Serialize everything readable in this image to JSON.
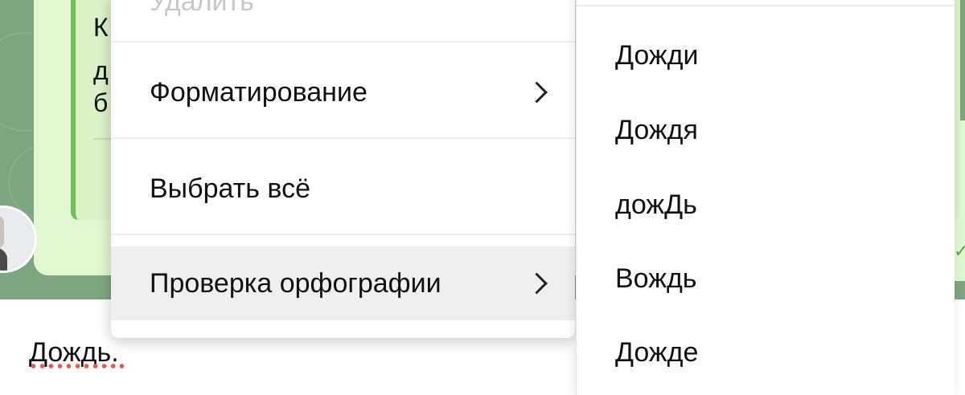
{
  "chat": {
    "quote_fragments": [
      "К",
      "д",
      "б"
    ]
  },
  "context_menu": {
    "items": [
      {
        "label": "Удалить"
      },
      {
        "label": "Форматирование"
      },
      {
        "label": "Выбрать всё"
      },
      {
        "label": "Проверка орфографии"
      }
    ]
  },
  "spellcheck_submenu": {
    "suggestions": [
      "Дожди",
      "Дождя",
      "дожДь",
      "Вождь",
      "Дожде"
    ]
  },
  "input": {
    "text": "Дождь."
  },
  "colors": {
    "chat_background": "#7ea581",
    "bubble": "#e1f7d1",
    "quote_accent": "#6fbf5a",
    "spell_error": "#e35a55",
    "highlight": "#efefef"
  }
}
